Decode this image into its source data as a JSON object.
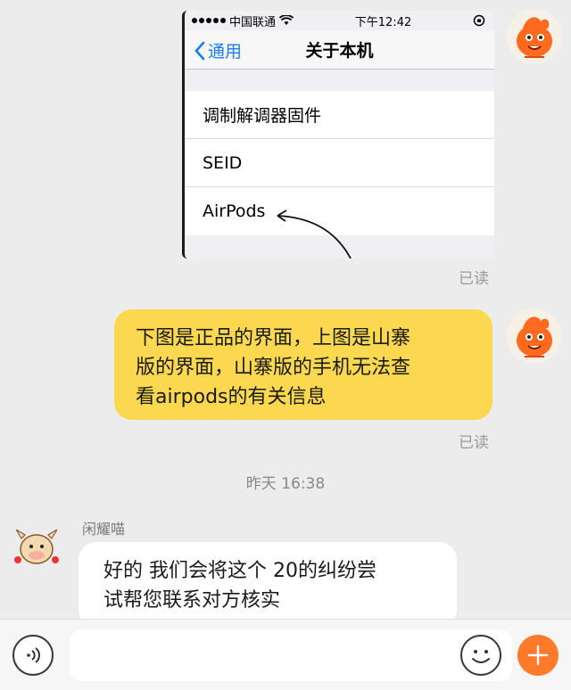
{
  "screenshot": {
    "status_bar": {
      "carrier": "中国联通",
      "time": "下午12:42"
    },
    "nav": {
      "back_label": "通用",
      "title": "关于本机"
    },
    "rows": [
      {
        "label": "调制解调器固件"
      },
      {
        "label": "SEID"
      },
      {
        "label": "AirPods"
      }
    ]
  },
  "messages": {
    "read_status_1": "已读",
    "outgoing_text": "下图是正品的界面，上图是山寨版的界面，山寨版的手机无法查看airpods的有关信息",
    "outgoing_lines": [
      "下图是正品的界面，上图是山寨",
      "版的界面，山寨版的手机无法查",
      "看airpods的有关信息"
    ],
    "read_status_2": "已读",
    "timestamp": "昨天 16:38",
    "sender_name": "闲耀喵",
    "incoming_lines": [
      "好的 我们会将这个 20的纠纷尝",
      "试帮您联系对方核实"
    ]
  },
  "input_bar": {
    "placeholder": ""
  },
  "colors": {
    "bubble_outgoing": "#fbd84f",
    "bubble_incoming": "#ffffff",
    "plus_button": "#ff7a2a",
    "ios_link": "#1a7cf5"
  },
  "icons": {
    "voice": "voice-wave-icon",
    "emoji": "smiley-face-icon",
    "plus": "plus-icon",
    "back": "chevron-left-icon",
    "wifi": "wifi-icon"
  }
}
